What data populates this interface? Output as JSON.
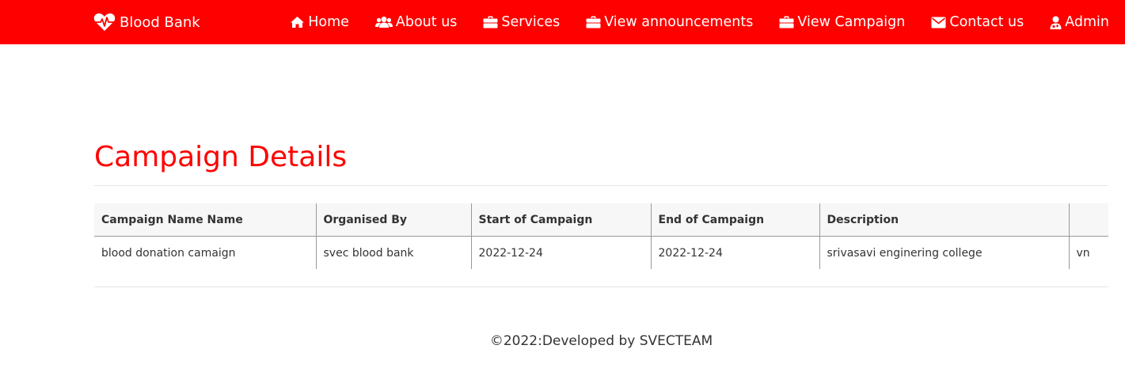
{
  "brand": {
    "name": "Blood Bank",
    "icon": "heartbeat-icon"
  },
  "nav": [
    {
      "label": "Home",
      "icon": "home-icon"
    },
    {
      "label": "About us",
      "icon": "users-icon"
    },
    {
      "label": "Services",
      "icon": "briefcase-icon"
    },
    {
      "label": "View announcements",
      "icon": "briefcase-icon"
    },
    {
      "label": "View Campaign",
      "icon": "briefcase-icon"
    },
    {
      "label": "Contact us",
      "icon": "envelope-icon"
    },
    {
      "label": "Admin",
      "icon": "user-md-icon"
    }
  ],
  "page": {
    "title": "Campaign Details"
  },
  "table": {
    "headers": [
      "Campaign Name Name",
      "Organised By",
      "Start of Campaign",
      "End of Campaign",
      "Description",
      ""
    ],
    "rows": [
      [
        "blood donation camaign",
        "svec blood bank",
        "2022-12-24",
        "2022-12-24",
        "srivasavi enginering college",
        "vn"
      ]
    ]
  },
  "footer": {
    "text": "©2022:Developed by SVECTEAM"
  },
  "colors": {
    "primary": "#ff0000",
    "header_bg": "#f7f7f7"
  }
}
